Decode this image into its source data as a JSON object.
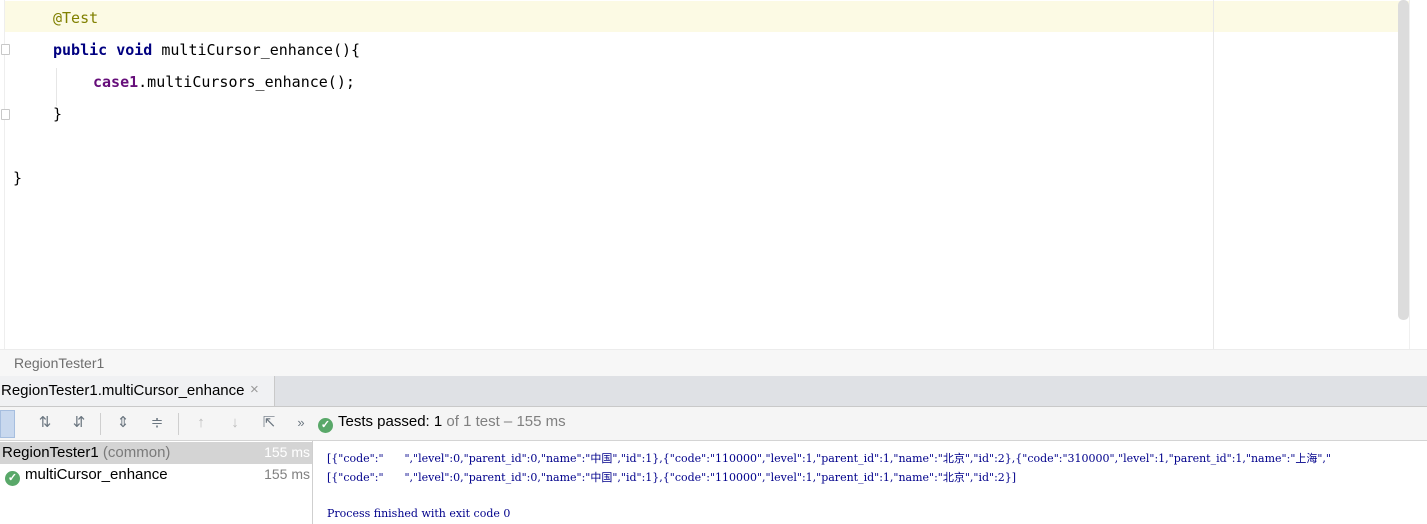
{
  "editor": {
    "lines": {
      "annotation": "@Test",
      "kw_public": "public",
      "kw_void": "void",
      "method_decl": " multiCursor_enhance(){",
      "field": "case1",
      "call": ".multiCursors_enhance();",
      "close_inner": "}",
      "close_outer": "}"
    }
  },
  "breadcrumb": {
    "class_name": "RegionTester1"
  },
  "run_panel": {
    "tab_label": "RegionTester1.multiCursor_enhance",
    "tab_close": "×",
    "more": "»",
    "status": {
      "prefix": "Tests passed: ",
      "count": "1",
      "suffix": " of 1 test – 155 ms"
    },
    "tree": {
      "root_name": "RegionTester1",
      "root_qualifier": "(common)",
      "root_time": "155 ms",
      "child_name": "multiCursor_enhance",
      "child_time": "155 ms"
    },
    "console": {
      "line1": "[{\"code\":\"      \",\"level\":0,\"parent_id\":0,\"name\":\"中国\",\"id\":1},{\"code\":\"110000\",\"level\":1,\"parent_id\":1,\"name\":\"北京\",\"id\":2},{\"code\":\"310000\",\"level\":1,\"parent_id\":1,\"name\":\"上海\",\"",
      "line2": "[{\"code\":\"      \",\"level\":0,\"parent_id\":0,\"name\":\"中国\",\"id\":1},{\"code\":\"110000\",\"level\":1,\"parent_id\":1,\"name\":\"北京\",\"id\":2}]",
      "line3": "Process finished with exit code 0"
    }
  },
  "colors": {
    "annotation": "#808000",
    "keyword": "#000080",
    "field": "#660e7a",
    "pass": "#59a869"
  }
}
